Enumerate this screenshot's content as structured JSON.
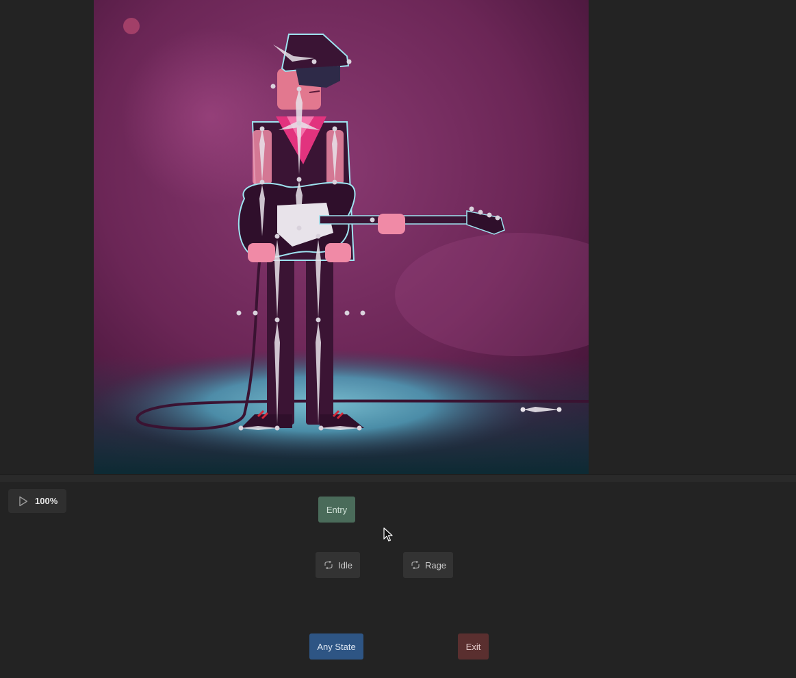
{
  "playback": {
    "zoom_label": "100%",
    "play_icon": "play-icon"
  },
  "state_machine": {
    "nodes": [
      {
        "id": "entry",
        "label": "Entry",
        "color": "#4a6b5a"
      },
      {
        "id": "idle",
        "label": "Idle",
        "icon": "loop-icon",
        "color": "#333333"
      },
      {
        "id": "rage",
        "label": "Rage",
        "icon": "loop-icon",
        "color": "#333333"
      },
      {
        "id": "any_state",
        "label": "Any State",
        "color": "#2e5584"
      },
      {
        "id": "exit",
        "label": "Exit",
        "color": "#5a2f2f"
      }
    ]
  },
  "colors": {
    "background": "#232323",
    "stage_purple": "#7a2d5e",
    "floor_cyan": "#5fb0c8",
    "bone_white": "#e8e3ea"
  }
}
